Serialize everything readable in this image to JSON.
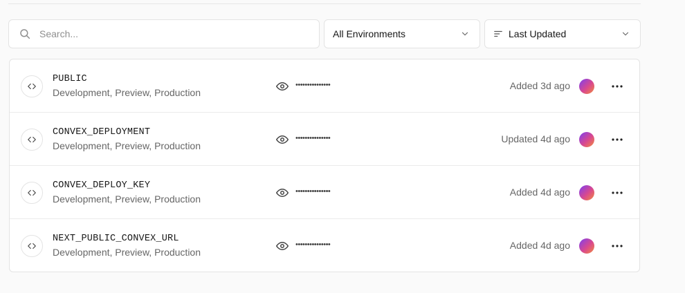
{
  "search": {
    "placeholder": "Search..."
  },
  "filters": {
    "environment": "All Environments",
    "sort": "Last Updated"
  },
  "variables": [
    {
      "name": "PUBLIC",
      "environments": "Development, Preview, Production",
      "value_masked": "•••••••••••••••",
      "updated": "Added 3d ago"
    },
    {
      "name": "CONVEX_DEPLOYMENT",
      "environments": "Development, Preview, Production",
      "value_masked": "•••••••••••••••",
      "updated": "Updated 4d ago"
    },
    {
      "name": "CONVEX_DEPLOY_KEY",
      "environments": "Development, Preview, Production",
      "value_masked": "•••••••••••••••",
      "updated": "Added 4d ago"
    },
    {
      "name": "NEXT_PUBLIC_CONVEX_URL",
      "environments": "Development, Preview, Production",
      "value_masked": "•••••••••••••••",
      "updated": "Added 4d ago"
    }
  ],
  "icons": {
    "search": "search-icon",
    "chevron": "chevron-down-icon",
    "sort": "sort-lines-icon",
    "code": "code-brackets-icon",
    "eye": "eye-icon",
    "more": "more-horizontal-icon"
  },
  "colors": {
    "border": "#e3e3e3",
    "muted_text": "#666666",
    "avatar_gradient": [
      "#7b3ff2",
      "#d9488f",
      "#f28b3c"
    ]
  }
}
